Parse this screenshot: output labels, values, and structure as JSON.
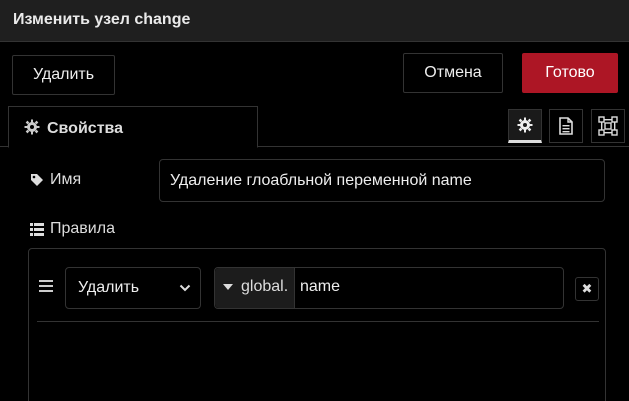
{
  "dialog": {
    "title": "Изменить узел change",
    "delete_label": "Удалить",
    "cancel_label": "Отмена",
    "done_label": "Готово"
  },
  "tabs": {
    "properties_label": "Свойства",
    "icon_tabs": [
      "gear-icon",
      "description-icon",
      "appearance-icon"
    ]
  },
  "form": {
    "name_label": "Имя",
    "name_value": "Удаление глоабльной переменной name",
    "rules_label": "Правила"
  },
  "rules": [
    {
      "action": "Удалить",
      "target_type": "global.",
      "target_value": "name"
    }
  ],
  "colors": {
    "done_button": "#ad1625",
    "background": "#000000",
    "border": "#333333"
  }
}
